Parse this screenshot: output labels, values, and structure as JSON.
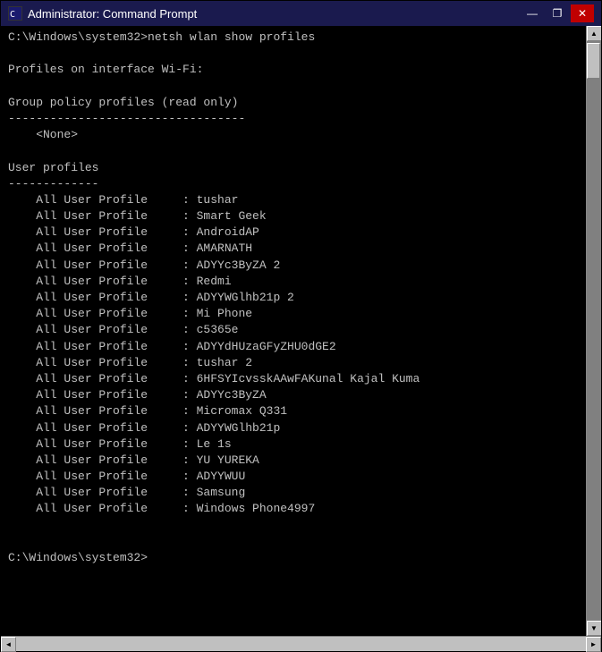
{
  "window": {
    "title": "Administrator: Command Prompt",
    "icon": "cmd-icon"
  },
  "titlebar": {
    "minimize_label": "—",
    "maximize_label": "❐",
    "close_label": "✕"
  },
  "terminal": {
    "content": "C:\\Windows\\system32>netsh wlan show profiles\n\nProfiles on interface Wi-Fi:\n\nGroup policy profiles (read only)\n----------------------------------\n    <None>\n\nUser profiles\n-------------\n    All User Profile     : tushar\n    All User Profile     : Smart Geek\n    All User Profile     : AndroidAP\n    All User Profile     : AMARNATH\n    All User Profile     : ADYYc3ByZA 2\n    All User Profile     : Redmi\n    All User Profile     : ADYYWGlhb21p 2\n    All User Profile     : Mi Phone\n    All User Profile     : c5365e\n    All User Profile     : ADYYdHUzaGFyZHU0dGE2\n    All User Profile     : tushar 2\n    All User Profile     : 6HFSYIcvsskAAwFAKunal Kajal Kuma\n    All User Profile     : ADYYc3ByZA\n    All User Profile     : Micromax Q331\n    All User Profile     : ADYYWGlhb21p\n    All User Profile     : Le 1s\n    All User Profile     : YU YUREKA\n    All User Profile     : ADYYWUU\n    All User Profile     : Samsung\n    All User Profile     : Windows Phone4997\n\n\nC:\\Windows\\system32>"
  },
  "scrollbar": {
    "up_arrow": "▲",
    "down_arrow": "▼",
    "left_arrow": "◄",
    "right_arrow": "►"
  }
}
